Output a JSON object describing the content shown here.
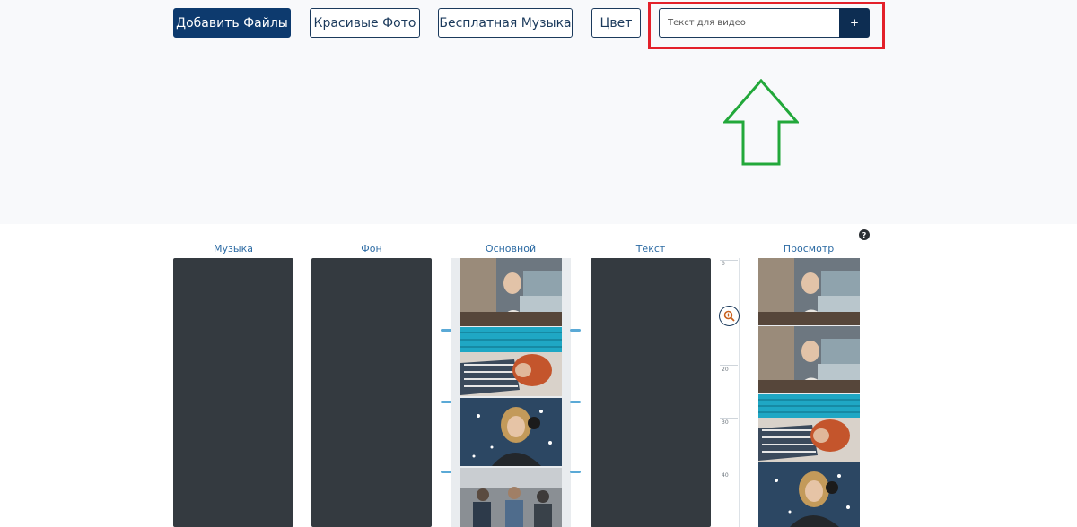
{
  "toolbar": {
    "add_files_label": "Добавить Файлы",
    "beautiful_photos_label": "Красивые Фото",
    "free_music_label": "Бесплатная Музыка",
    "color_label": "Цвет",
    "text_input": {
      "placeholder": "Текст для видео",
      "value": ""
    },
    "add_text_label": "+"
  },
  "columns": {
    "music": "Музыка",
    "background": "Фон",
    "main": "Основной",
    "text": "Текст",
    "preview": "Просмотр"
  },
  "ruler": {
    "ticks": [
      "0",
      "10",
      "20",
      "30",
      "40"
    ]
  },
  "help_label": "?",
  "colors": {
    "primary": "#0d3a6e",
    "track_dark": "#343a40",
    "label_blue": "#2b6aa3",
    "highlight_red": "#e3202a",
    "arrow_green": "#22a83a"
  },
  "icons": {
    "zoom": "zoom-in-icon",
    "help": "question-icon",
    "arrow": "up-arrow-icon"
  }
}
